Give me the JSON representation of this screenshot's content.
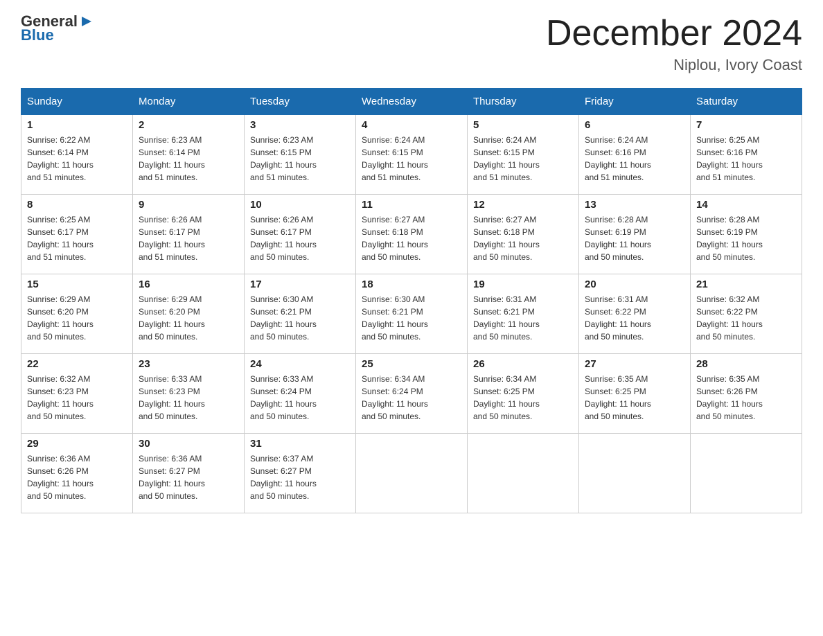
{
  "logo": {
    "general": "General",
    "arrow": "▶",
    "blue": "Blue"
  },
  "title": "December 2024",
  "subtitle": "Niplou, Ivory Coast",
  "weekdays": [
    "Sunday",
    "Monday",
    "Tuesday",
    "Wednesday",
    "Thursday",
    "Friday",
    "Saturday"
  ],
  "weeks": [
    [
      {
        "day": "1",
        "sunrise": "6:22 AM",
        "sunset": "6:14 PM",
        "daylight": "11 hours and 51 minutes."
      },
      {
        "day": "2",
        "sunrise": "6:23 AM",
        "sunset": "6:14 PM",
        "daylight": "11 hours and 51 minutes."
      },
      {
        "day": "3",
        "sunrise": "6:23 AM",
        "sunset": "6:15 PM",
        "daylight": "11 hours and 51 minutes."
      },
      {
        "day": "4",
        "sunrise": "6:24 AM",
        "sunset": "6:15 PM",
        "daylight": "11 hours and 51 minutes."
      },
      {
        "day": "5",
        "sunrise": "6:24 AM",
        "sunset": "6:15 PM",
        "daylight": "11 hours and 51 minutes."
      },
      {
        "day": "6",
        "sunrise": "6:24 AM",
        "sunset": "6:16 PM",
        "daylight": "11 hours and 51 minutes."
      },
      {
        "day": "7",
        "sunrise": "6:25 AM",
        "sunset": "6:16 PM",
        "daylight": "11 hours and 51 minutes."
      }
    ],
    [
      {
        "day": "8",
        "sunrise": "6:25 AM",
        "sunset": "6:17 PM",
        "daylight": "11 hours and 51 minutes."
      },
      {
        "day": "9",
        "sunrise": "6:26 AM",
        "sunset": "6:17 PM",
        "daylight": "11 hours and 51 minutes."
      },
      {
        "day": "10",
        "sunrise": "6:26 AM",
        "sunset": "6:17 PM",
        "daylight": "11 hours and 50 minutes."
      },
      {
        "day": "11",
        "sunrise": "6:27 AM",
        "sunset": "6:18 PM",
        "daylight": "11 hours and 50 minutes."
      },
      {
        "day": "12",
        "sunrise": "6:27 AM",
        "sunset": "6:18 PM",
        "daylight": "11 hours and 50 minutes."
      },
      {
        "day": "13",
        "sunrise": "6:28 AM",
        "sunset": "6:19 PM",
        "daylight": "11 hours and 50 minutes."
      },
      {
        "day": "14",
        "sunrise": "6:28 AM",
        "sunset": "6:19 PM",
        "daylight": "11 hours and 50 minutes."
      }
    ],
    [
      {
        "day": "15",
        "sunrise": "6:29 AM",
        "sunset": "6:20 PM",
        "daylight": "11 hours and 50 minutes."
      },
      {
        "day": "16",
        "sunrise": "6:29 AM",
        "sunset": "6:20 PM",
        "daylight": "11 hours and 50 minutes."
      },
      {
        "day": "17",
        "sunrise": "6:30 AM",
        "sunset": "6:21 PM",
        "daylight": "11 hours and 50 minutes."
      },
      {
        "day": "18",
        "sunrise": "6:30 AM",
        "sunset": "6:21 PM",
        "daylight": "11 hours and 50 minutes."
      },
      {
        "day": "19",
        "sunrise": "6:31 AM",
        "sunset": "6:21 PM",
        "daylight": "11 hours and 50 minutes."
      },
      {
        "day": "20",
        "sunrise": "6:31 AM",
        "sunset": "6:22 PM",
        "daylight": "11 hours and 50 minutes."
      },
      {
        "day": "21",
        "sunrise": "6:32 AM",
        "sunset": "6:22 PM",
        "daylight": "11 hours and 50 minutes."
      }
    ],
    [
      {
        "day": "22",
        "sunrise": "6:32 AM",
        "sunset": "6:23 PM",
        "daylight": "11 hours and 50 minutes."
      },
      {
        "day": "23",
        "sunrise": "6:33 AM",
        "sunset": "6:23 PM",
        "daylight": "11 hours and 50 minutes."
      },
      {
        "day": "24",
        "sunrise": "6:33 AM",
        "sunset": "6:24 PM",
        "daylight": "11 hours and 50 minutes."
      },
      {
        "day": "25",
        "sunrise": "6:34 AM",
        "sunset": "6:24 PM",
        "daylight": "11 hours and 50 minutes."
      },
      {
        "day": "26",
        "sunrise": "6:34 AM",
        "sunset": "6:25 PM",
        "daylight": "11 hours and 50 minutes."
      },
      {
        "day": "27",
        "sunrise": "6:35 AM",
        "sunset": "6:25 PM",
        "daylight": "11 hours and 50 minutes."
      },
      {
        "day": "28",
        "sunrise": "6:35 AM",
        "sunset": "6:26 PM",
        "daylight": "11 hours and 50 minutes."
      }
    ],
    [
      {
        "day": "29",
        "sunrise": "6:36 AM",
        "sunset": "6:26 PM",
        "daylight": "11 hours and 50 minutes."
      },
      {
        "day": "30",
        "sunrise": "6:36 AM",
        "sunset": "6:27 PM",
        "daylight": "11 hours and 50 minutes."
      },
      {
        "day": "31",
        "sunrise": "6:37 AM",
        "sunset": "6:27 PM",
        "daylight": "11 hours and 50 minutes."
      },
      null,
      null,
      null,
      null
    ]
  ],
  "labels": {
    "sunrise": "Sunrise:",
    "sunset": "Sunset:",
    "daylight": "Daylight:"
  }
}
